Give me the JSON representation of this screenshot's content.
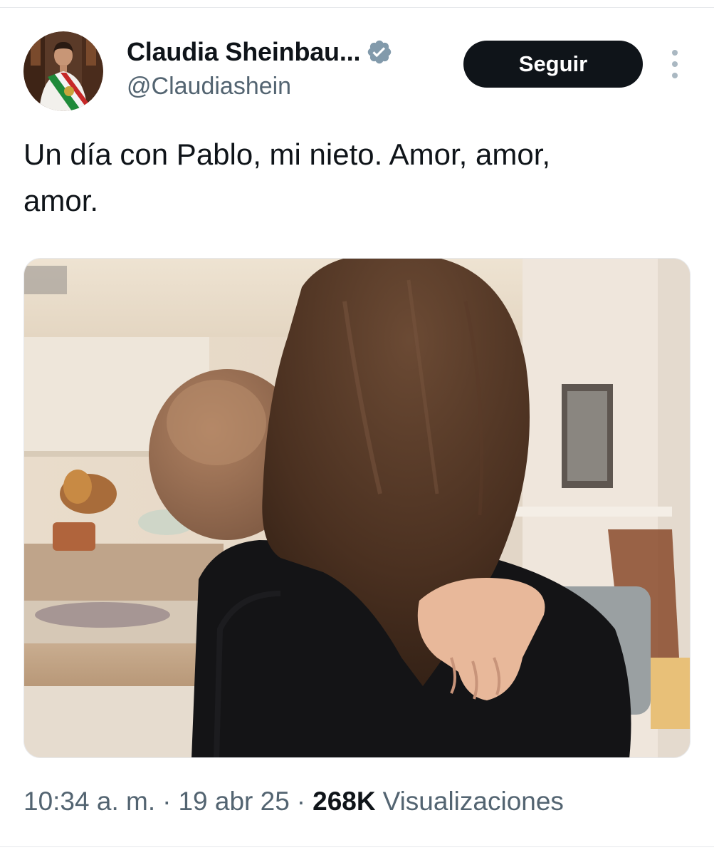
{
  "author": {
    "display_name": "Claudia Sheinbau...",
    "handle": "@Claudiashein",
    "verified": true
  },
  "actions": {
    "follow_label": "Seguir"
  },
  "tweet": {
    "text": "Un día con Pablo, mi nieto. Amor, amor,\namor.",
    "time": "10:34 a. m.",
    "separator": "·",
    "date": "19 abr 25",
    "views_count": "268K",
    "views_label": "Visualizaciones"
  },
  "colors": {
    "text_primary": "#0f1419",
    "text_secondary": "#536471",
    "follow_bg": "#0f1419",
    "verified_badge": "#829aab"
  },
  "icons": {
    "verified": "verified-badge-icon",
    "more": "more-options-icon"
  }
}
